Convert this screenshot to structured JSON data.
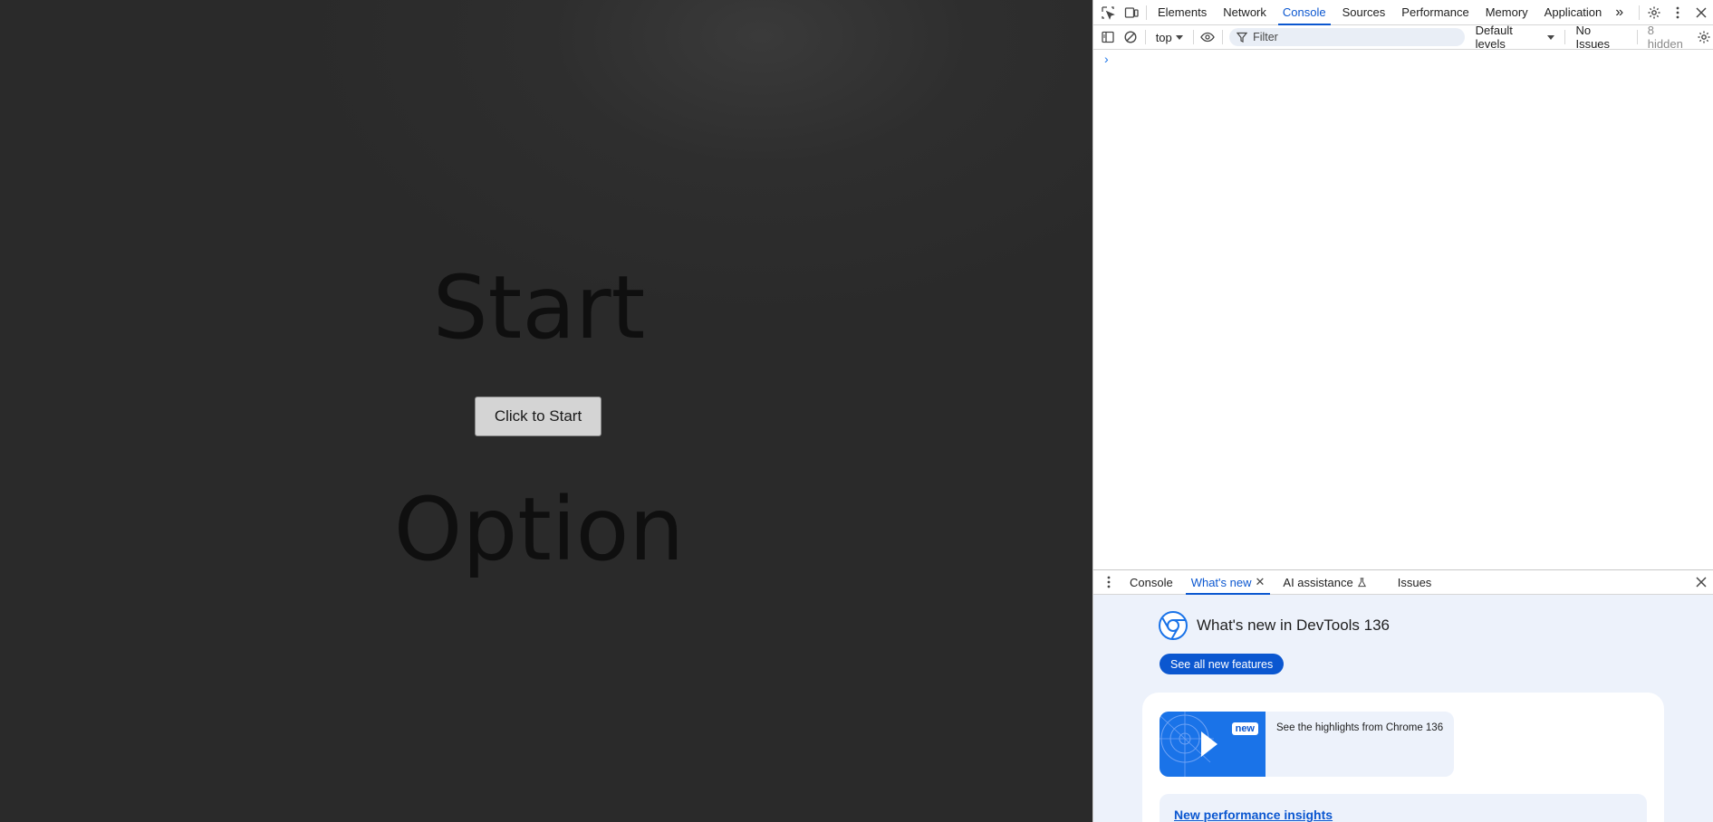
{
  "game": {
    "start_title": "Start",
    "start_button_label": "Click to Start",
    "option_title": "Option"
  },
  "devtools": {
    "tabs": [
      {
        "label": "Elements"
      },
      {
        "label": "Network"
      },
      {
        "label": "Console",
        "active": true
      },
      {
        "label": "Sources"
      },
      {
        "label": "Performance"
      },
      {
        "label": "Memory"
      },
      {
        "label": "Application"
      }
    ],
    "more_tabs_glyph": "»",
    "console_toolbar": {
      "context": "top",
      "filter_placeholder": "Filter",
      "levels": "Default levels",
      "issues": "No Issues",
      "hidden": "8 hidden"
    },
    "prompt_glyph": "›",
    "drawer": {
      "tabs": [
        {
          "label": "Console"
        },
        {
          "label": "What's new",
          "active": true
        },
        {
          "label": "AI assistance"
        },
        {
          "label": "Issues"
        }
      ],
      "whats_new_title": "What's new in DevTools 136",
      "see_all_label": "See all new features",
      "video_badge": "new",
      "video_text": "See the highlights from Chrome 136",
      "insights_link": "New performance insights"
    }
  },
  "colors": {
    "accent": "#0b57d0",
    "viewport_bg": "#2b2b2b",
    "drawer_bg": "#edf2fb"
  }
}
